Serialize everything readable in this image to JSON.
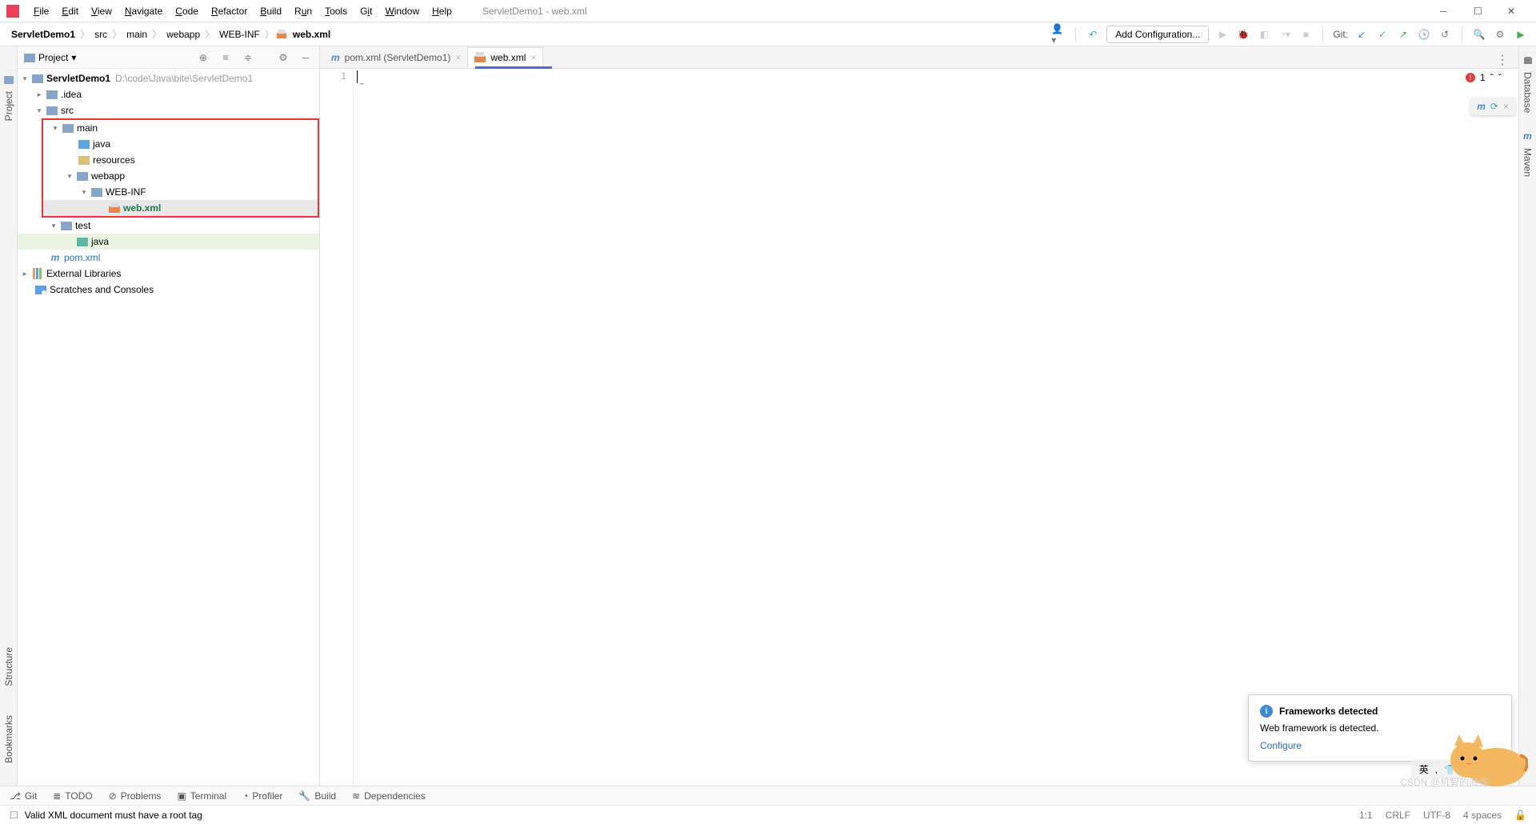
{
  "window": {
    "title": "ServletDemo1 - web.xml"
  },
  "menu": [
    "File",
    "Edit",
    "View",
    "Navigate",
    "Code",
    "Refactor",
    "Build",
    "Run",
    "Tools",
    "Git",
    "Window",
    "Help"
  ],
  "breadcrumb": [
    "ServletDemo1",
    "src",
    "main",
    "webapp",
    "WEB-INF",
    "web.xml"
  ],
  "nav": {
    "config_btn": "Add Configuration...",
    "git_label": "Git:"
  },
  "sidebar": {
    "title": "Project",
    "tree": {
      "root": "ServletDemo1",
      "root_path": "D:\\code\\Java\\bite\\ServletDemo1",
      "idea": ".idea",
      "src": "src",
      "main": "main",
      "java1": "java",
      "resources": "resources",
      "webapp": "webapp",
      "webinf": "WEB-INF",
      "webxml": "web.xml",
      "test": "test",
      "java2": "java",
      "pom": "pom.xml",
      "ext": "External Libraries",
      "scratches": "Scratches and Consoles"
    }
  },
  "tabs": [
    {
      "label": "pom.xml (ServletDemo1)"
    },
    {
      "label": "web.xml"
    }
  ],
  "editor": {
    "line_no": "1",
    "error_count": "1"
  },
  "left_tabs": [
    "Project",
    "Structure",
    "Bookmarks"
  ],
  "right_tabs": [
    "Database",
    "Maven"
  ],
  "bottom": [
    "Git",
    "TODO",
    "Problems",
    "Terminal",
    "Profiler",
    "Build",
    "Dependencies"
  ],
  "status": {
    "message": "Valid XML document must have a root tag",
    "pos": "1:1",
    "eol": "CRLF",
    "enc": "UTF-8",
    "indent": "4 spaces"
  },
  "popup": {
    "title": "Frameworks detected",
    "body": "Web framework is detected.",
    "link": "Configure"
  },
  "ime": {
    "lang": "英",
    "sep": ","
  },
  "watermark": "CSDN @机智的海绵"
}
